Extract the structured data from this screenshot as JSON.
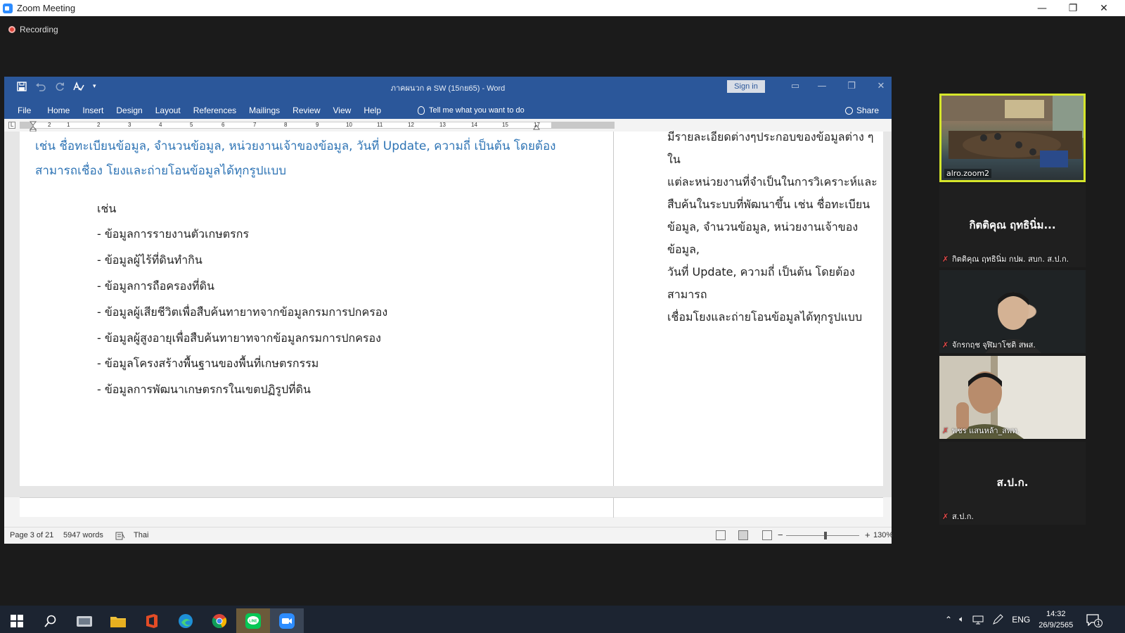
{
  "zoom": {
    "window_title": "Zoom Meeting",
    "recording_label": "Recording",
    "window_controls": {
      "minimize": "—",
      "maximize": "❐",
      "close": "✕"
    }
  },
  "word": {
    "doc_title": "ภาคผนวก ค SW (15กย65)  -  Word",
    "sign_in": "Sign in",
    "tabs": [
      "File",
      "Home",
      "Insert",
      "Design",
      "Layout",
      "References",
      "Mailings",
      "Review",
      "View",
      "Help"
    ],
    "tell_me": "Tell me what you want to do",
    "share": "Share",
    "ruler_numbers": [
      "1",
      "2",
      "1",
      "2",
      "3",
      "4",
      "5",
      "6",
      "7",
      "8",
      "9",
      "10",
      "11",
      "12",
      "13",
      "14",
      "15",
      "17"
    ],
    "left_page": {
      "blue_paragraph": "เช่น ชื่อทะเบียนข้อมูล, จำนวนข้อมูล, หน่วยงานเจ้าของข้อมูล, วันที่ Update, ความถี่ เป็นต้น โดยต้องสามารถเชื่อง โยงและถ่ายโอนข้อมูลได้ทุกรูปแบบ",
      "heading": "เช่น",
      "items": [
        "- ข้อมูลการรายงานตัวเกษตรกร",
        "- ข้อมูลผู้ไร้ที่ดินทำกิน",
        "- ข้อมูลการถือครองที่ดิน",
        "- ข้อมูลผู้เสียชีวิตเพื่อสืบค้นทายาทจากข้อมูลกรมการปกครอง",
        "- ข้อมูลผู้สูงอายุเพื่อสืบค้นทายาทจากข้อมูลกรมการปกครอง",
        "- ข้อมูลโครงสร้างพื้นฐานของพื้นที่เกษตรกรรม",
        "- ข้อมูลการพัฒนาเกษตรกรในเขตปฏิรูปที่ดิน"
      ]
    },
    "right_page": {
      "lines": [
        "มีรายละเอียดต่างๆประกอบของข้อมูลต่าง ๆ ใน",
        "แต่ละหน่วยงานที่จำเป็นในการวิเคราะห์และ",
        "สืบค้นในระบบที่พัฒนาขึ้น เช่น ชื่อทะเบียน",
        "ข้อมูล, จำนวนข้อมูล, หน่วยงานเจ้าของข้อมูล,",
        "วันที่ Update, ความถี่ เป็นต้น โดยต้องสามารถ",
        "เชื่อมโยงและถ่ายโอนข้อมูลได้ทุกรูปแบบ"
      ]
    },
    "status": {
      "page": "Page 3 of 21",
      "words": "5947 words",
      "language": "Thai",
      "zoom": "130%",
      "zoom_percent": 130
    }
  },
  "participants": [
    {
      "name": "alro.zoom2",
      "active": true
    },
    {
      "display_name": "กิตติคุณ ฤทธินิ่ม...",
      "name": "กิตติคุณ ฤทธินิ่ม กปผ. สบก. ส.ป.ก."
    },
    {
      "name": "จักรกฤช จุฬิมาโชติ สพส."
    },
    {
      "name": "พชร แสนหล้า_สพท."
    },
    {
      "display_name": "ส.ป.ก.",
      "name": "ส.ป.ก."
    }
  ],
  "taskbar": {
    "apps": [
      "start-icon",
      "search-icon",
      "app-icon",
      "file-explorer-icon",
      "office-icon",
      "edge-icon",
      "chrome-icon",
      "line-icon",
      "zoom-icon"
    ],
    "language": "ENG",
    "time": "14:32",
    "date": "26/9/2565",
    "notifications": "1"
  },
  "colors": {
    "word_blue": "#2b579a",
    "doc_blue_text": "#2e74b5",
    "active_speaker": "#d6e62b",
    "line_green": "#06c755",
    "zoom_blue": "#2d8cff"
  }
}
